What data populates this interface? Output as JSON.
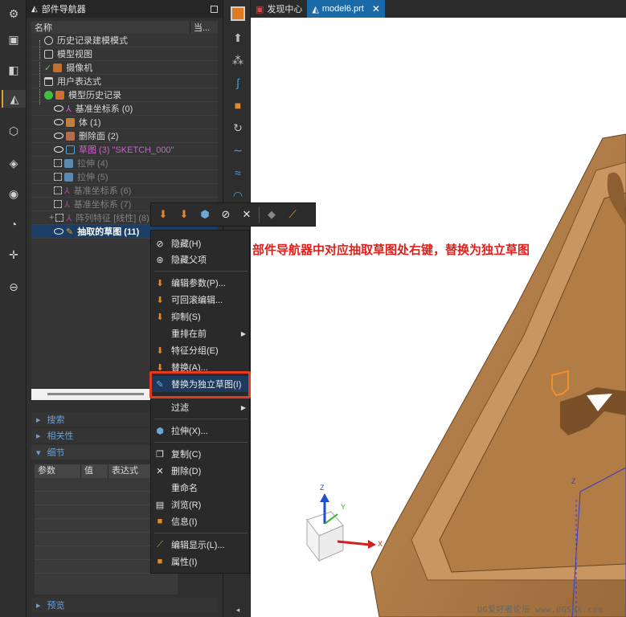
{
  "navigator": {
    "title": "部件导航器",
    "col_name": "名称",
    "col_current": "当...",
    "rows": [
      {
        "label": "历史记录建模模式"
      },
      {
        "label": "模型视图"
      },
      {
        "label": "摄像机"
      },
      {
        "label": "用户表达式"
      },
      {
        "label": "模型历史记录"
      },
      {
        "label": "基准坐标系 (0)"
      },
      {
        "label": "体 (1)"
      },
      {
        "label": "删除面 (2)"
      },
      {
        "label": "草图 (3) \"SKETCH_000\""
      },
      {
        "label": "拉伸 (4)"
      },
      {
        "label": "拉伸 (5)"
      },
      {
        "label": "基准坐标系 (6)"
      },
      {
        "label": "基准坐标系 (7)"
      },
      {
        "label": "阵列特征 [线性] (8)"
      },
      {
        "label": "抽取的草图 (11)"
      }
    ]
  },
  "sections": {
    "search": "搜索",
    "relevance": "相关性",
    "details": "细节",
    "preview": "预览"
  },
  "details_table": {
    "headers": [
      "参数",
      "值",
      "表达式"
    ]
  },
  "tabs": [
    {
      "label": "发现中心"
    },
    {
      "label": "model6.prt"
    }
  ],
  "context_menu": {
    "items": [
      "隐藏(H)",
      "隐藏父项",
      "编辑参数(P)...",
      "可回滚编辑...",
      "抑制(S)",
      "重排在前",
      "特征分组(E)",
      "替换(A)...",
      "替换为独立草图(I)",
      "过滤",
      "拉伸(X)...",
      "复制(C)",
      "删除(D)",
      "重命名",
      "浏览(R)",
      "信息(I)",
      "编辑显示(L)...",
      "属性(I)"
    ]
  },
  "annotation": "部件导航器中对应抽取草图处右键，替换为独立草图",
  "watermark": "UG爱好者论坛 www.UGSNX.com",
  "axes": {
    "x": "X",
    "y": "Y",
    "z": "Z"
  },
  "colors": {
    "highlight_border": "#e33a22",
    "model_body": "#b8834f",
    "active_tab": "#1b6aa8"
  }
}
